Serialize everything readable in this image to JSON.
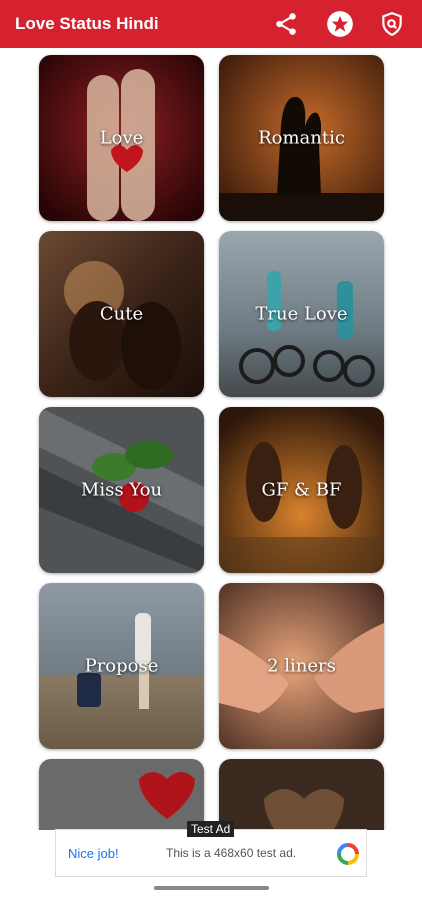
{
  "app": {
    "title": "Love Status Hindi"
  },
  "toolbar": {
    "share_icon": "share-icon",
    "rate_icon": "star-icon",
    "privacy_icon": "shield-search-icon"
  },
  "categories": [
    {
      "label": "Love"
    },
    {
      "label": "Romantic"
    },
    {
      "label": "Cute"
    },
    {
      "label": "True Love"
    },
    {
      "label": "Miss You"
    },
    {
      "label": "GF & BF"
    },
    {
      "label": "Propose"
    },
    {
      "label": "2 liners"
    },
    {
      "label": ""
    },
    {
      "label": ""
    }
  ],
  "ad": {
    "tag": "Test Ad",
    "headline": "Nice job!",
    "description": "This is a 468x60 test ad."
  },
  "colors": {
    "appbar": "#d6212f"
  }
}
